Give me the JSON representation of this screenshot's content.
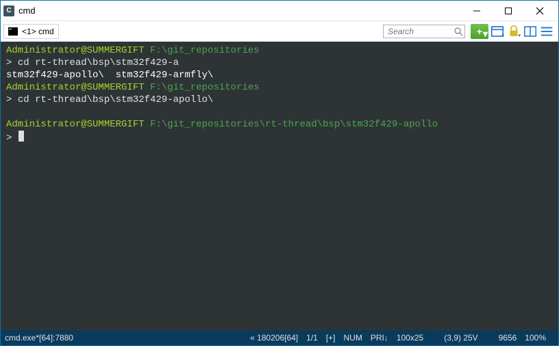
{
  "titlebar": {
    "title": "cmd",
    "app_icon_letter": "C"
  },
  "tabbar": {
    "tab_label": "<1> cmd",
    "search_placeholder": "Search"
  },
  "toolbar": {
    "add_plus": "+"
  },
  "terminal": {
    "l1_user": "Administrator@SUMMERGIFT ",
    "l1_path": "F:\\git_repositories",
    "l2_prompt": "> ",
    "l2_cmd": "cd rt-thread\\bsp\\stm32f429-a",
    "l3_completions": "stm32f429-apollo\\  stm32f429-armfly\\",
    "l4_user": "Administrator@SUMMERGIFT ",
    "l4_path": "F:\\git_repositories",
    "l5_prompt": "> ",
    "l5_cmd": "cd rt-thread\\bsp\\stm32f429-apollo\\",
    "l7_user": "Administrator@SUMMERGIFT ",
    "l7_path": "F:\\git_repositories\\rt-thread\\bsp\\stm32f429-apollo",
    "l8_prompt": "> "
  },
  "statusbar": {
    "left": "cmd.exe*[64]:7880",
    "time": "« 180206[64]",
    "frac": "1/1",
    "plus": "[+]",
    "num": "NUM",
    "pri": "PRI↓",
    "size": "100x25",
    "pos": "(3,9) 25V",
    "mem": "9656",
    "pct": "100%"
  }
}
